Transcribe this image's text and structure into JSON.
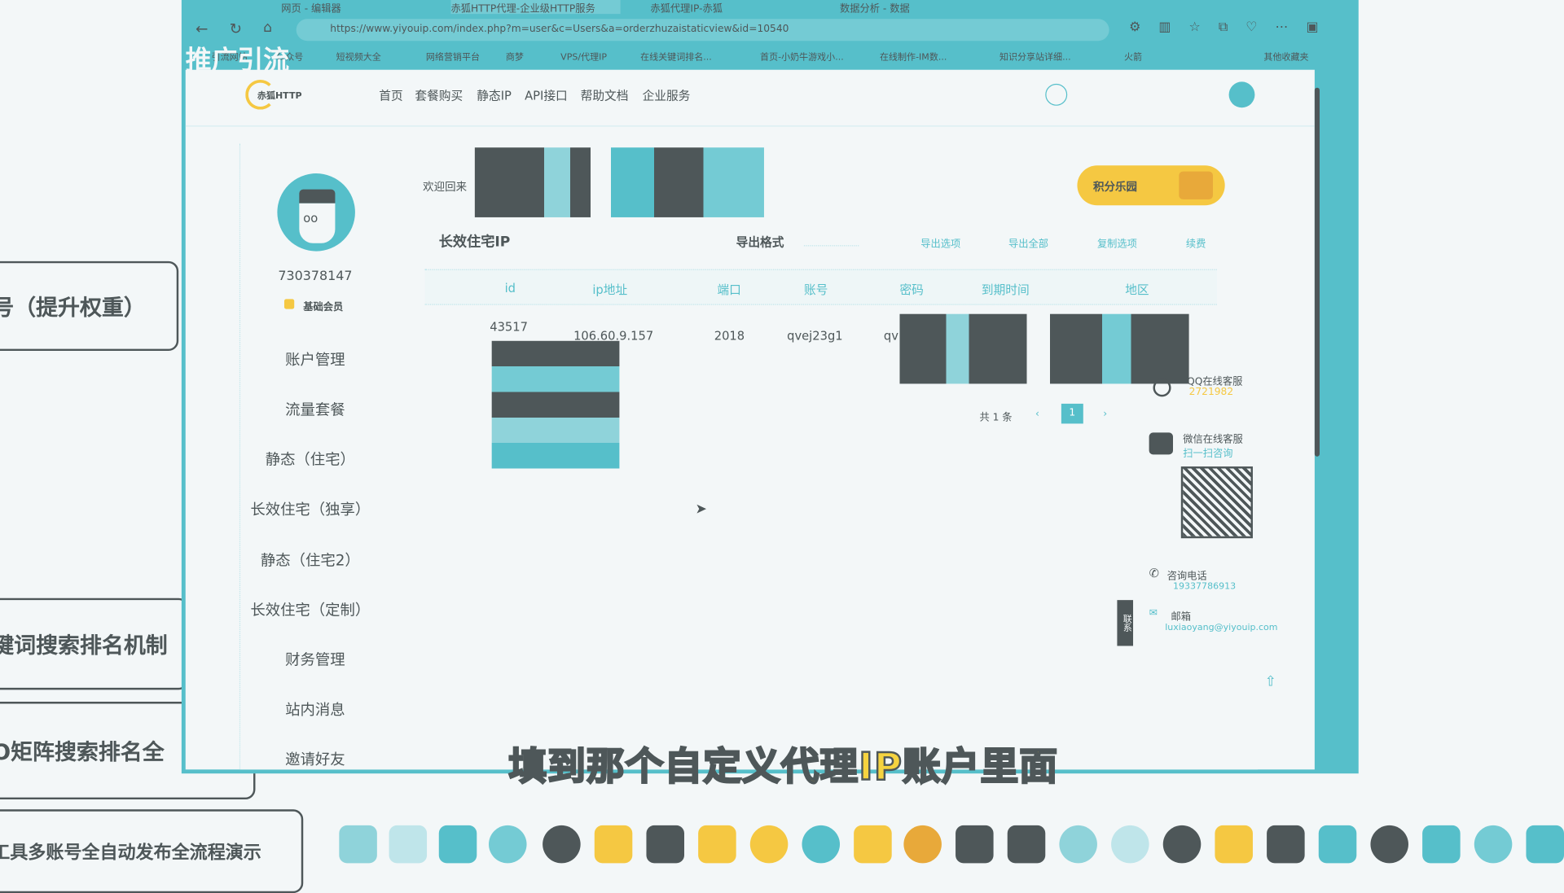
{
  "background_mindmap": {
    "nodes": [
      "号（提升权重）",
      "键词搜索排名机制",
      "O矩阵搜索排名全",
      "工具多账号全自动发布全流程演示"
    ],
    "overlay_title": "推广引流"
  },
  "browser": {
    "tabs": [
      "网页 - 编辑器",
      "赤狐HTTP代理-企业级HTTP服务",
      "赤狐代理IP-赤狐",
      "数据分析 - 数据"
    ],
    "url": "https://www.yiyouip.com/index.php?m=user&c=Users&a=orderzhuzaistaticview&id=10540",
    "bookmarks": [
      "引流网站",
      "公众号",
      "短视频大全",
      "网络营销平台",
      "商梦",
      "VPS/代理IP",
      "在线关键词排名...",
      "首页-小奶牛游戏小...",
      "在线制作-IM数...",
      "知识分享站详细...",
      "火箭",
      "其他收藏夹"
    ]
  },
  "site": {
    "logo": "赤狐HTTP",
    "nav": [
      "首页",
      "套餐购买",
      "静态IP",
      "API接口",
      "帮助文档",
      "企业服务"
    ],
    "user_id": "730378147",
    "member_level": "基础会员",
    "sidebar": [
      "账户管理",
      "流量套餐",
      "静态（住宅）",
      "长效住宅（独享）",
      "静态（住宅2）",
      "长效住宅（定制）",
      "财务管理",
      "站内消息",
      "邀请好友"
    ],
    "welcome": "欢迎回来",
    "points_button": "积分乐园",
    "section_title": "长效住宅IP",
    "export_label": "导出格式",
    "actions": [
      "导出选项",
      "导出全部",
      "复制选项",
      "续费"
    ],
    "table": {
      "headers": [
        "id",
        "ip地址",
        "端口",
        "账号",
        "密码",
        "到期时间",
        "地区"
      ],
      "rows": [
        {
          "id": "43517",
          "ip": "106.60.9.157",
          "port": "2018",
          "account": "qvej23g1",
          "password": "qv"
        }
      ]
    },
    "pagination": {
      "total": "共 1 条",
      "prev": "‹",
      "current": "1",
      "next": "›"
    },
    "contact": {
      "qq_label": "QQ在线客服",
      "qq_number": "2721982",
      "wechat_label": "微信在线客服",
      "wechat_sub": "扫一扫咨询",
      "phone_label": "咨询电话",
      "phone": "19337786913",
      "email_label": "邮箱",
      "email": "luxiaoyang@yiyouip.com"
    },
    "side_tab": "联系"
  },
  "subtitle": "填到那个自定义代理IP账户里面",
  "colors": {
    "accent": "#56bfca",
    "dark": "#4e5759",
    "yellow": "#f5c842",
    "bg": "#f3f7f8"
  }
}
